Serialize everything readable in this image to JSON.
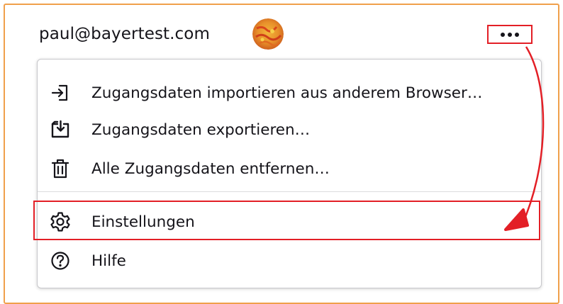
{
  "account": {
    "email": "paul@bayertest.com"
  },
  "more_button": {
    "icon": "ellipsis-icon"
  },
  "menu": {
    "items": [
      {
        "label": "Zugangsdaten importieren aus anderem Browser…",
        "icon": "import-icon"
      },
      {
        "label": "Zugangsdaten exportieren…",
        "icon": "export-icon"
      },
      {
        "label": "Alle Zugangsdaten entfernen…",
        "icon": "trash-icon"
      },
      {
        "label": "Einstellungen",
        "icon": "gear-icon"
      },
      {
        "label": "Hilfe",
        "icon": "help-icon"
      }
    ]
  },
  "colors": {
    "frame_border": "#f0a04b",
    "annotation_red": "#e31f26",
    "text": "#15141a",
    "menu_border": "#c8c8cc"
  }
}
